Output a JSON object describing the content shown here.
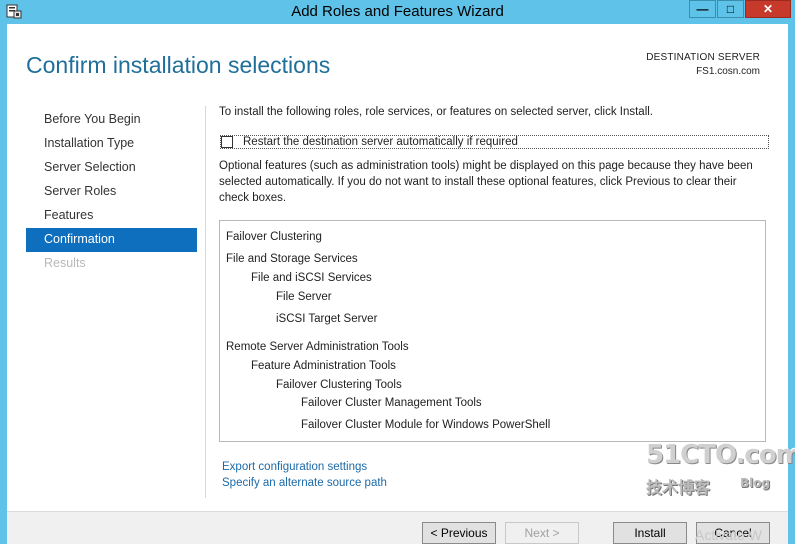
{
  "window": {
    "title": "Add Roles and Features Wizard",
    "minimize_glyph": "—",
    "maximize_glyph": "□",
    "close_glyph": "✕"
  },
  "page": {
    "title": "Confirm installation selections",
    "destination_label": "DESTINATION SERVER",
    "destination_name": "FS1.cosn.com"
  },
  "nav": {
    "items": [
      {
        "label": "Before You Begin",
        "state": "normal"
      },
      {
        "label": "Installation Type",
        "state": "normal"
      },
      {
        "label": "Server Selection",
        "state": "normal"
      },
      {
        "label": "Server Roles",
        "state": "normal"
      },
      {
        "label": "Features",
        "state": "normal"
      },
      {
        "label": "Confirmation",
        "state": "active"
      },
      {
        "label": "Results",
        "state": "disabled"
      }
    ]
  },
  "content": {
    "intro": "To install the following roles, role services, or features on selected server, click Install.",
    "restart_label": "Restart the destination server automatically if required",
    "restart_checked": false,
    "optional_text": "Optional features (such as administration tools) might be displayed on this page because they have been selected automatically. If you do not want to install these optional features, click Previous to clear their check boxes.",
    "selections": [
      {
        "label": "Failover Clustering",
        "level": 0
      },
      {
        "label": "File and Storage Services",
        "level": 0
      },
      {
        "label": "File and iSCSI Services",
        "level": 1
      },
      {
        "label": "File Server",
        "level": 2
      },
      {
        "label": "iSCSI Target Server",
        "level": 2
      },
      {
        "label": "Remote Server Administration Tools",
        "level": 0
      },
      {
        "label": "Feature Administration Tools",
        "level": 1
      },
      {
        "label": "Failover Clustering Tools",
        "level": 2
      },
      {
        "label": "Failover Cluster Management Tools",
        "level": 3
      },
      {
        "label": "Failover Cluster Module for Windows PowerShell",
        "level": 3
      }
    ],
    "export_link": "Export configuration settings",
    "source_link": "Specify an alternate source path"
  },
  "footer": {
    "previous": "< Previous",
    "next": "Next >",
    "install": "Install",
    "cancel": "Cancel"
  },
  "overlay": {
    "watermark_main": "51CTO.com",
    "watermark_sub": "技术博客",
    "watermark_blog": "Blog",
    "activate": "Activate W"
  },
  "colors": {
    "titlebar": "#5fc2e8",
    "accent": "#0f6fbf",
    "title_text": "#1f6f9a",
    "link": "#1c6aa8"
  }
}
